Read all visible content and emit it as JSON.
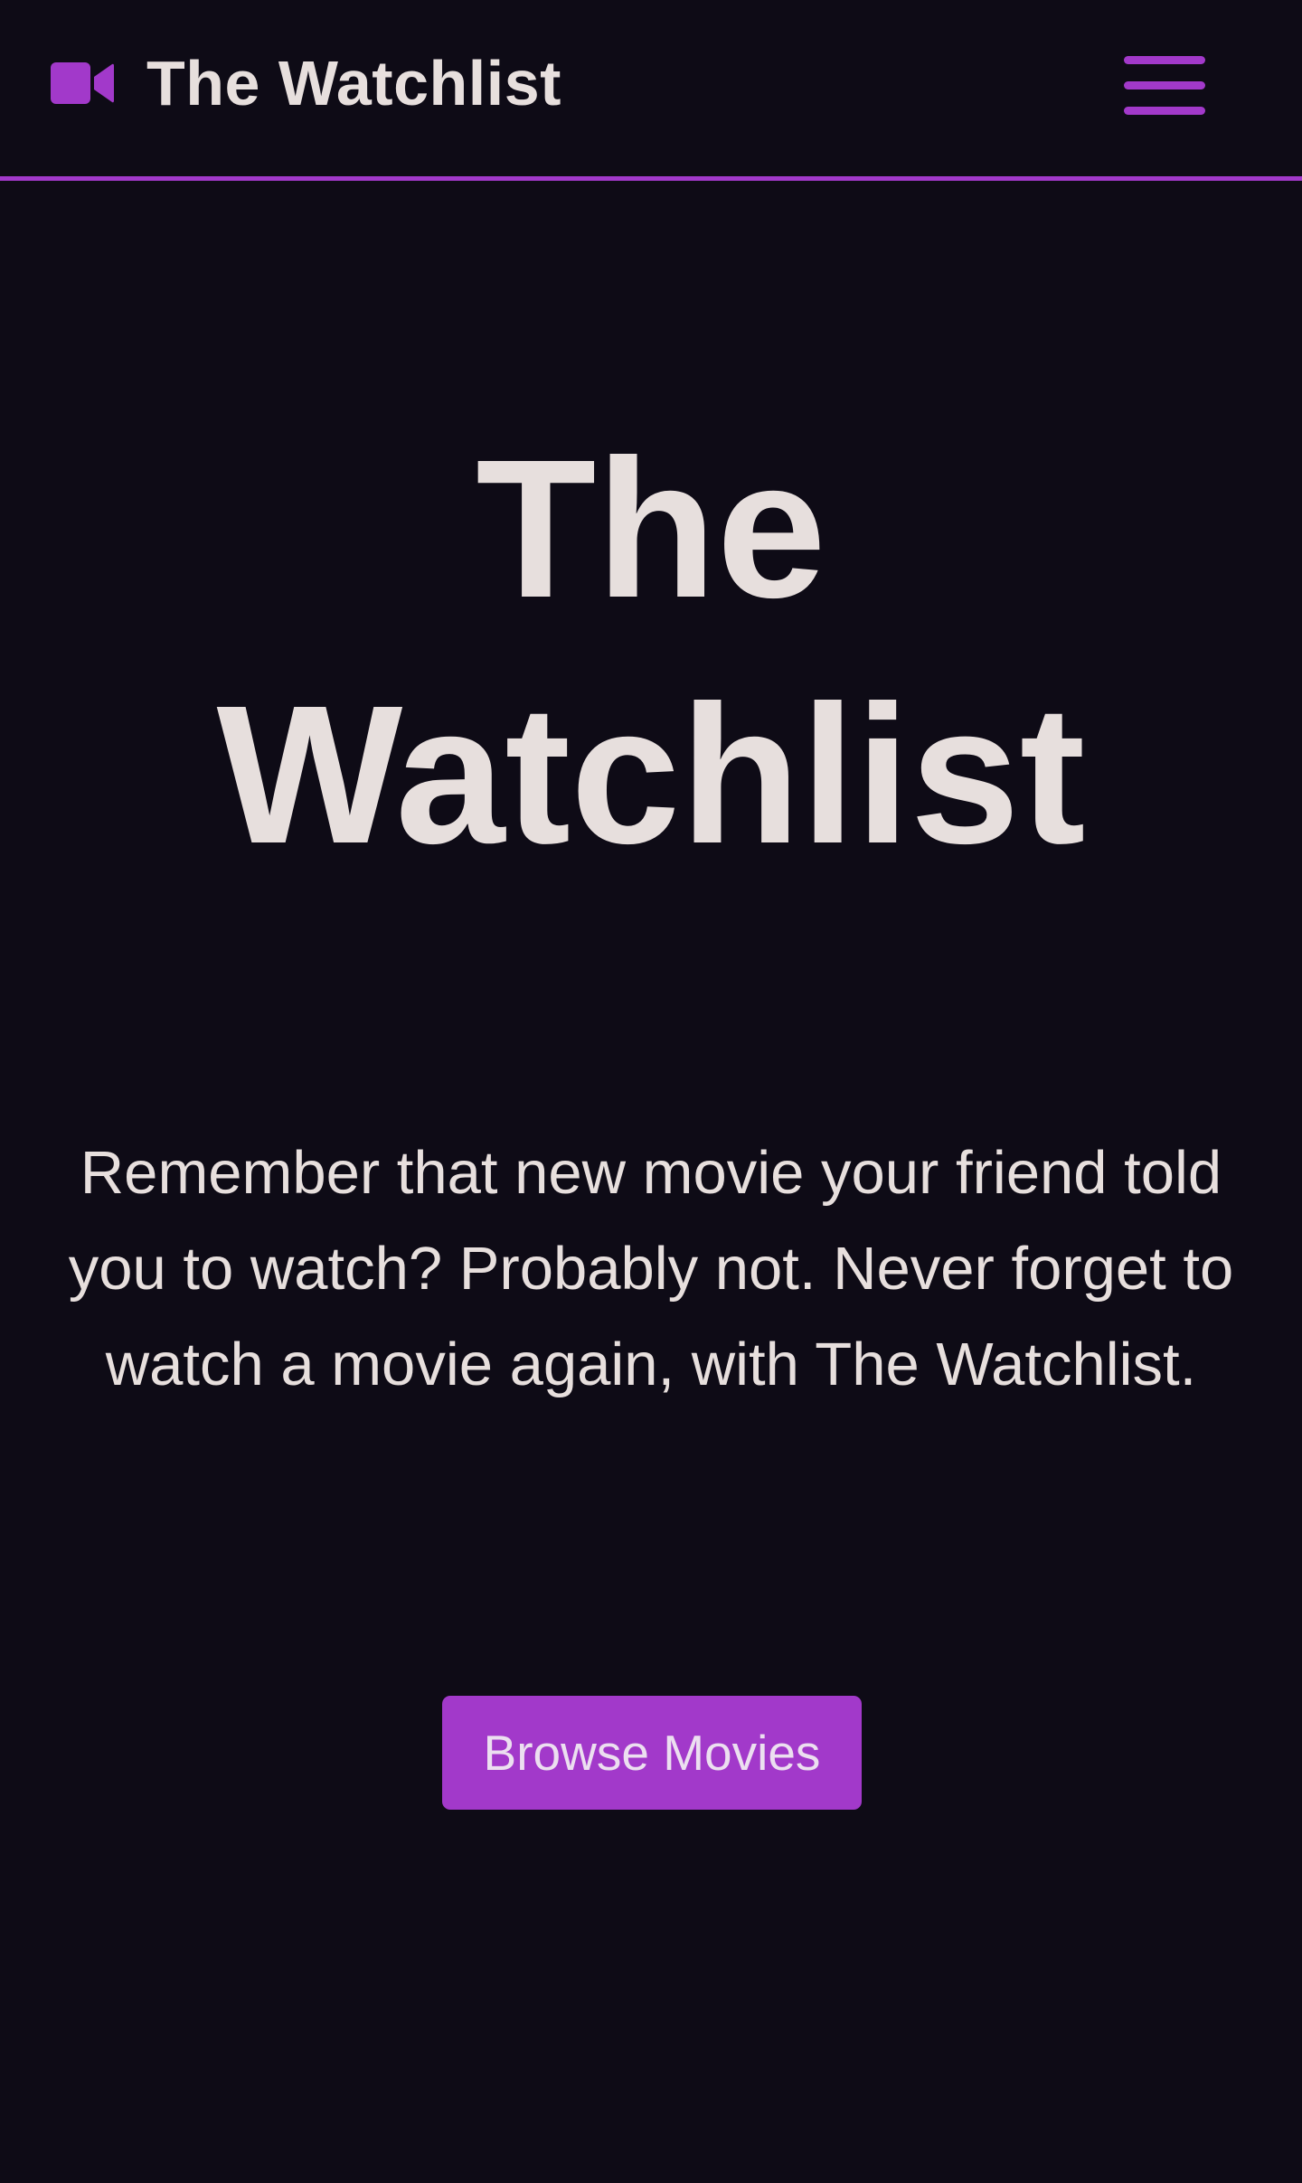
{
  "navbar": {
    "brand_icon": "video-camera-icon",
    "brand_name": "The Watchlist",
    "menu_icon": "hamburger-menu-icon"
  },
  "hero": {
    "title_line1": "The",
    "title_line2": "Watchlist",
    "description": "Remember that new movie your friend told you to watch? Probably not. Never forget to watch a movie again, with The Watchlist.",
    "cta_label": "Browse Movies"
  },
  "colors": {
    "background": "#0e0b16",
    "accent": "#a239ca",
    "text": "#e7dfdd"
  }
}
